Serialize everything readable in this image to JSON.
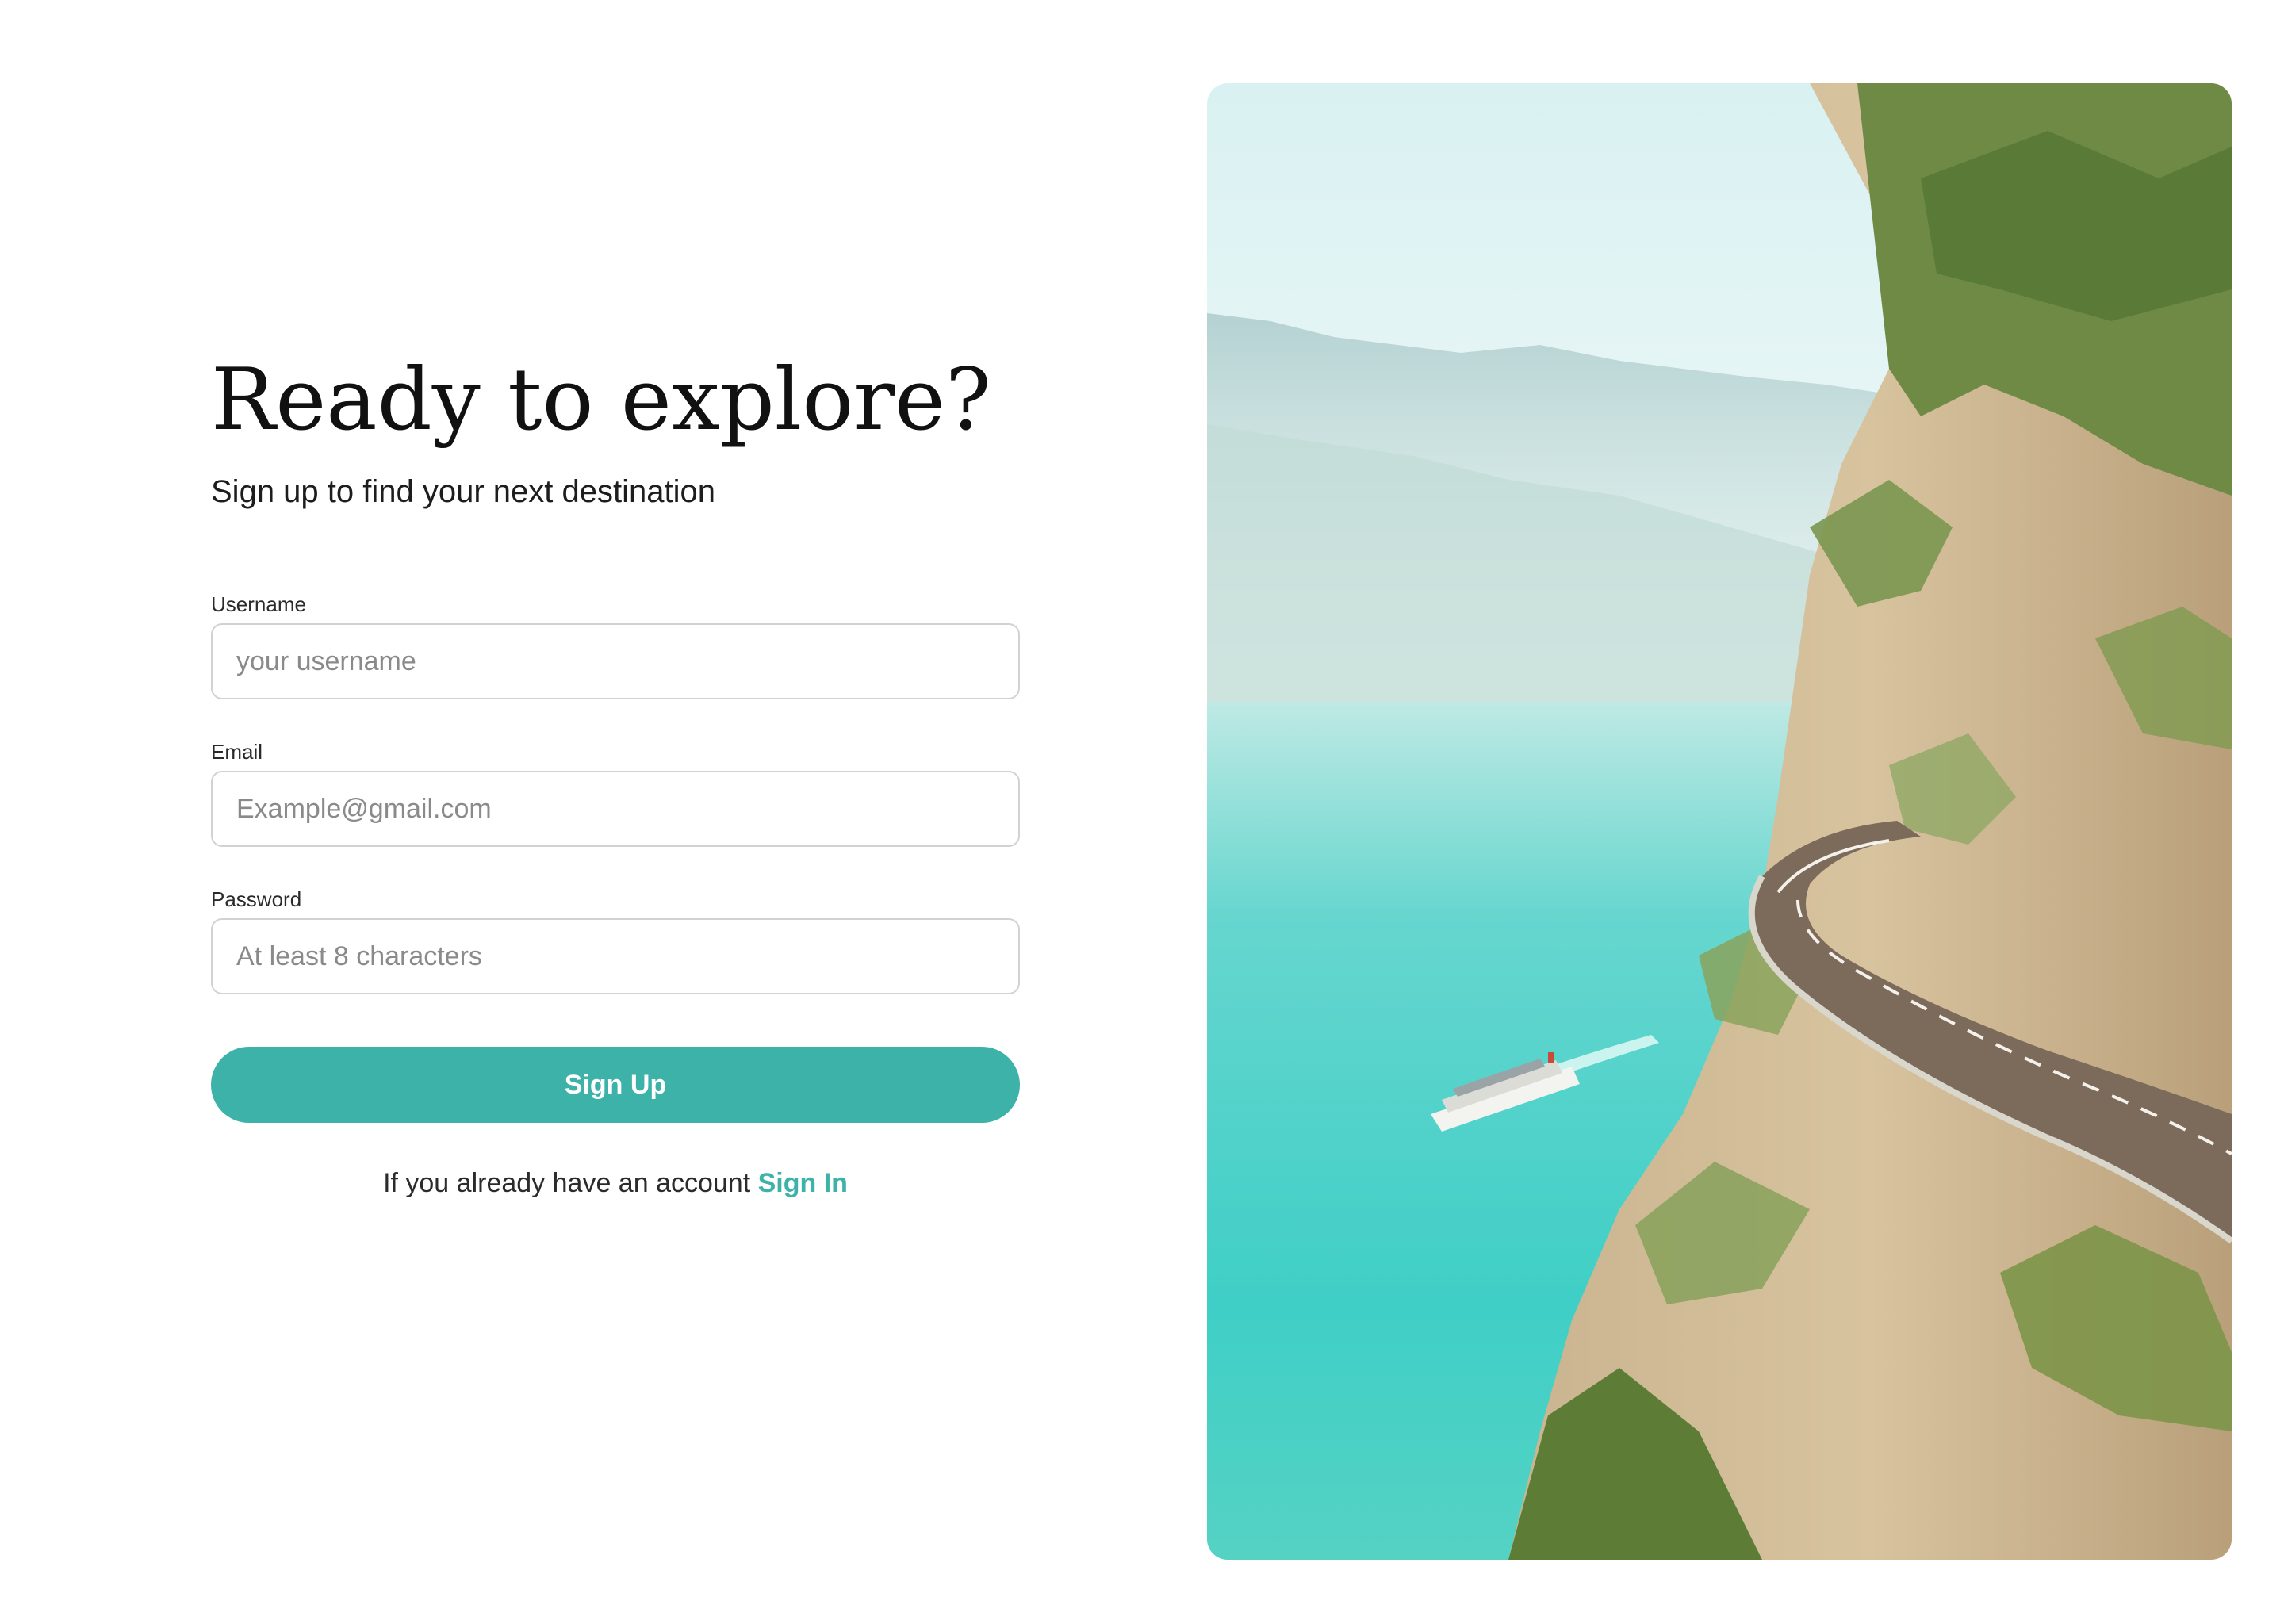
{
  "header": {
    "title": "Ready to explore?",
    "subtitle": "Sign up to find your next destination"
  },
  "form": {
    "username": {
      "label": "Username",
      "placeholder": "your username"
    },
    "email": {
      "label": "Email",
      "placeholder": "Example@gmail.com"
    },
    "password": {
      "label": "Password",
      "placeholder": "At least 8 characters"
    },
    "submit_label": "Sign Up"
  },
  "footer": {
    "prompt": "If you already have an account",
    "signin_label": "Sign In"
  },
  "colors": {
    "accent": "#3db2a9",
    "input_border": "#d2d2d2",
    "water": "#4fd1c9",
    "sky": "#eaf7f6"
  },
  "hero_image": {
    "icon": "coastal-road-photo"
  }
}
